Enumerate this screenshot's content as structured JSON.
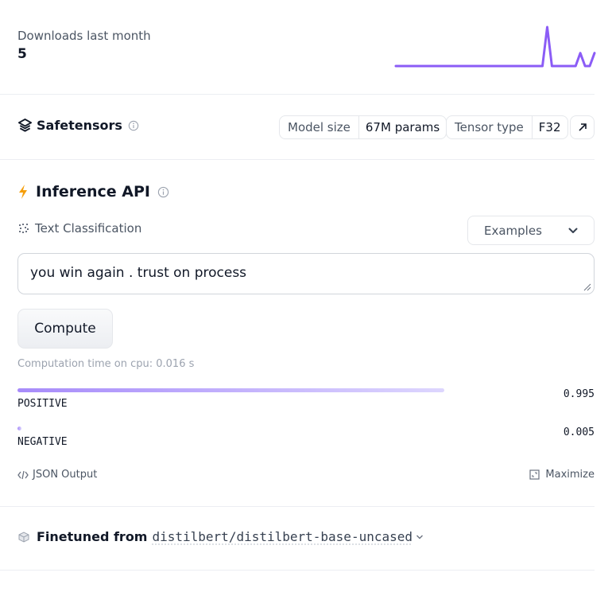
{
  "downloads": {
    "label": "Downloads last month",
    "value": "5",
    "sparkline_counts": [
      0,
      0,
      0,
      0,
      0,
      0,
      0,
      0,
      0,
      0,
      0,
      0,
      0,
      0,
      0,
      0,
      0,
      0,
      0,
      0,
      0,
      0,
      0,
      0,
      0,
      0,
      0,
      0,
      0,
      0,
      0,
      0,
      3,
      0,
      0,
      0,
      0,
      0,
      0,
      1,
      0,
      0,
      1
    ],
    "sparkline_color": "#8b5cf6"
  },
  "safetensors": {
    "title": "Safetensors",
    "model_size_label": "Model size",
    "model_size_value": "67M params",
    "tensor_type_label": "Tensor type",
    "tensor_type_value": "F32"
  },
  "inference": {
    "title": "Inference API",
    "task_label": "Text Classification",
    "examples_label": "Examples",
    "input_value": "you win again . trust on process",
    "compute_label": "Compute",
    "computation_time": "Computation time on cpu: 0.016 s",
    "results": [
      {
        "label": "POSITIVE",
        "score": "0.995",
        "score_value": 0.995
      },
      {
        "label": "NEGATIVE",
        "score": "0.005",
        "score_value": 0.005
      }
    ],
    "json_output_label": "JSON Output",
    "maximize_label": "Maximize",
    "bar_color": "#a78bfa"
  },
  "finetuned": {
    "label": "Finetuned from",
    "model": "distilbert/distilbert-base-uncased"
  }
}
